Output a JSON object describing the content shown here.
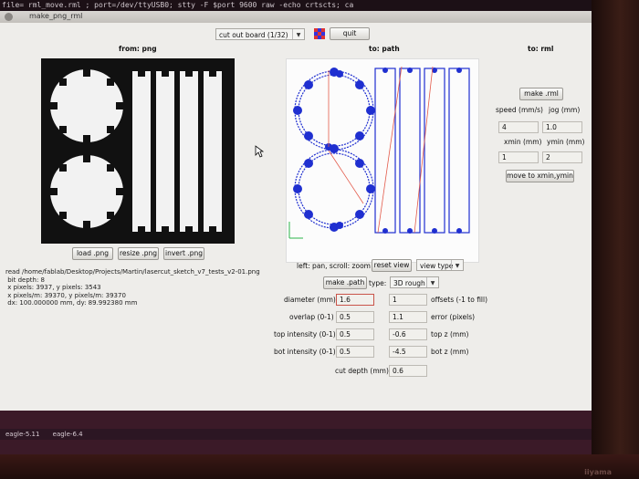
{
  "terminal": {
    "text": "file= rml_move.rml ; port=/dev/ttyUSB0; stty -F $port 9600 raw -echo crtscts; ca"
  },
  "window": {
    "title": "make_png_rml"
  },
  "toolbar": {
    "mode_select": "cut out board (1/32)",
    "quit_label": "quit"
  },
  "png_panel": {
    "heading": "from: png",
    "load_label": "load .png",
    "resize_label": "resize .png",
    "invert_label": "invert .png"
  },
  "path_panel": {
    "heading": "to: path",
    "nav_hint": "left: pan, scroll: zoom",
    "reset_view_label": "reset view",
    "view_type_select": "view type",
    "make_path_label": "make .path",
    "type_label": "type:",
    "type_select": "3D rough"
  },
  "rml_panel": {
    "heading": "to: rml",
    "make_rml_label": "make .rml",
    "speed_label": "speed (mm/s)",
    "speed_value": "4",
    "jog_label": "jog (mm)",
    "jog_value": "1.0",
    "xmin_label": "xmin (mm)",
    "xmin_value": "1",
    "ymin_label": "ymin (mm)",
    "ymin_value": "2",
    "move_label": "move to xmin,ymin"
  },
  "file_info": {
    "text": "read /home/fablab/Desktop/Projects/Martin/lasercut_sketch_v7_tests_v2-01.png\n bit depth: 8\n x pixels: 3937, y pixels: 3543\n x pixels/m: 39370, y pixels/m: 39370\n dx: 100.000000 mm, dy: 89.992380 mm"
  },
  "params": {
    "diameter_label": "diameter (mm)",
    "diameter_value": "1.6",
    "offsets_value": "1",
    "offsets_label": "offsets (-1 to fill)",
    "overlap_label": "overlap (0-1)",
    "overlap_value": "0.5",
    "error_value": "1.1",
    "error_label": "error (pixels)",
    "top_intensity_label": "top intensity (0-1)",
    "top_intensity_value": "0.5",
    "top_z_value": "-0.6",
    "top_z_label": "top z (mm)",
    "bot_intensity_label": "bot intensity (0-1)",
    "bot_intensity_value": "0.5",
    "bot_z_value": "-4.5",
    "bot_z_label": "bot z (mm)",
    "cut_depth_label": "cut depth (mm)",
    "cut_depth_value": "0.6"
  },
  "taskbar": {
    "item1": "eagle-5.11",
    "item2": "eagle-6.4"
  },
  "monitor": {
    "brand": "iiyama"
  },
  "colors": {
    "path_blue": "#1f2fd0",
    "path_red": "#e35a4a",
    "window_bg": "#eeedea"
  }
}
